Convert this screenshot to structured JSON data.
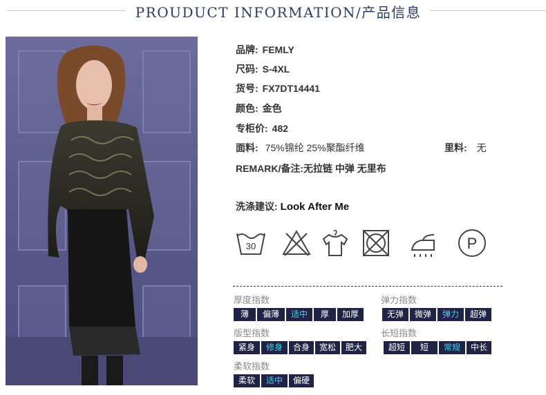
{
  "header": {
    "title": "PROUDUCT INFORMATION/产品信息"
  },
  "info": {
    "brand": {
      "label": "品牌:",
      "value": "FEMLY"
    },
    "size": {
      "label": "尺码:",
      "value": "S-4XL"
    },
    "sku": {
      "label": "货号:",
      "value": "FX7DT14441"
    },
    "color": {
      "label": "颜色:",
      "value": "金色"
    },
    "price": {
      "label": "专柜价:",
      "value": "482"
    },
    "fabric": {
      "label": "面料:",
      "value": "75%锦纶 25%聚酯纤维"
    },
    "lining": {
      "label": "里料:",
      "value": "无"
    },
    "remark": {
      "label": "REMARK/备注:",
      "value": "无拉链 中弹 无里布"
    }
  },
  "care": {
    "label": "洗涤建议:",
    "value": "Look After Me",
    "wash_temp": "30",
    "dry_clean_letter": "P",
    "icons": [
      "wash-30-icon",
      "no-bleach-icon",
      "hang-dry-icon",
      "no-tumble-dry-icon",
      "iron-icon",
      "dry-clean-p-icon"
    ]
  },
  "indices": {
    "thickness": {
      "label": "厚度指数",
      "options": [
        "薄",
        "偏薄",
        "适中",
        "厚",
        "加厚"
      ],
      "selected": "适中"
    },
    "elasticity": {
      "label": "弹力指数",
      "options": [
        "无弹",
        "微弹",
        "弹力",
        "超弹"
      ],
      "selected": "弹力"
    },
    "fit": {
      "label": "版型指数",
      "options": [
        "紧身",
        "修身",
        "合身",
        "宽松",
        "肥大"
      ],
      "selected": "修身"
    },
    "length": {
      "label": "长短指数",
      "options": [
        "超短",
        "短",
        "常规",
        "中长"
      ],
      "selected": "常规"
    },
    "softness": {
      "label": "柔软指数",
      "options": [
        "柔软",
        "适中",
        "偏硬"
      ],
      "selected": "适中"
    }
  },
  "colors": {
    "title": "#2b3a67",
    "tag_bg": "#1f2345",
    "tag_selected_text": "#3fd3f0",
    "photo_bg": "#5b5b8c"
  }
}
